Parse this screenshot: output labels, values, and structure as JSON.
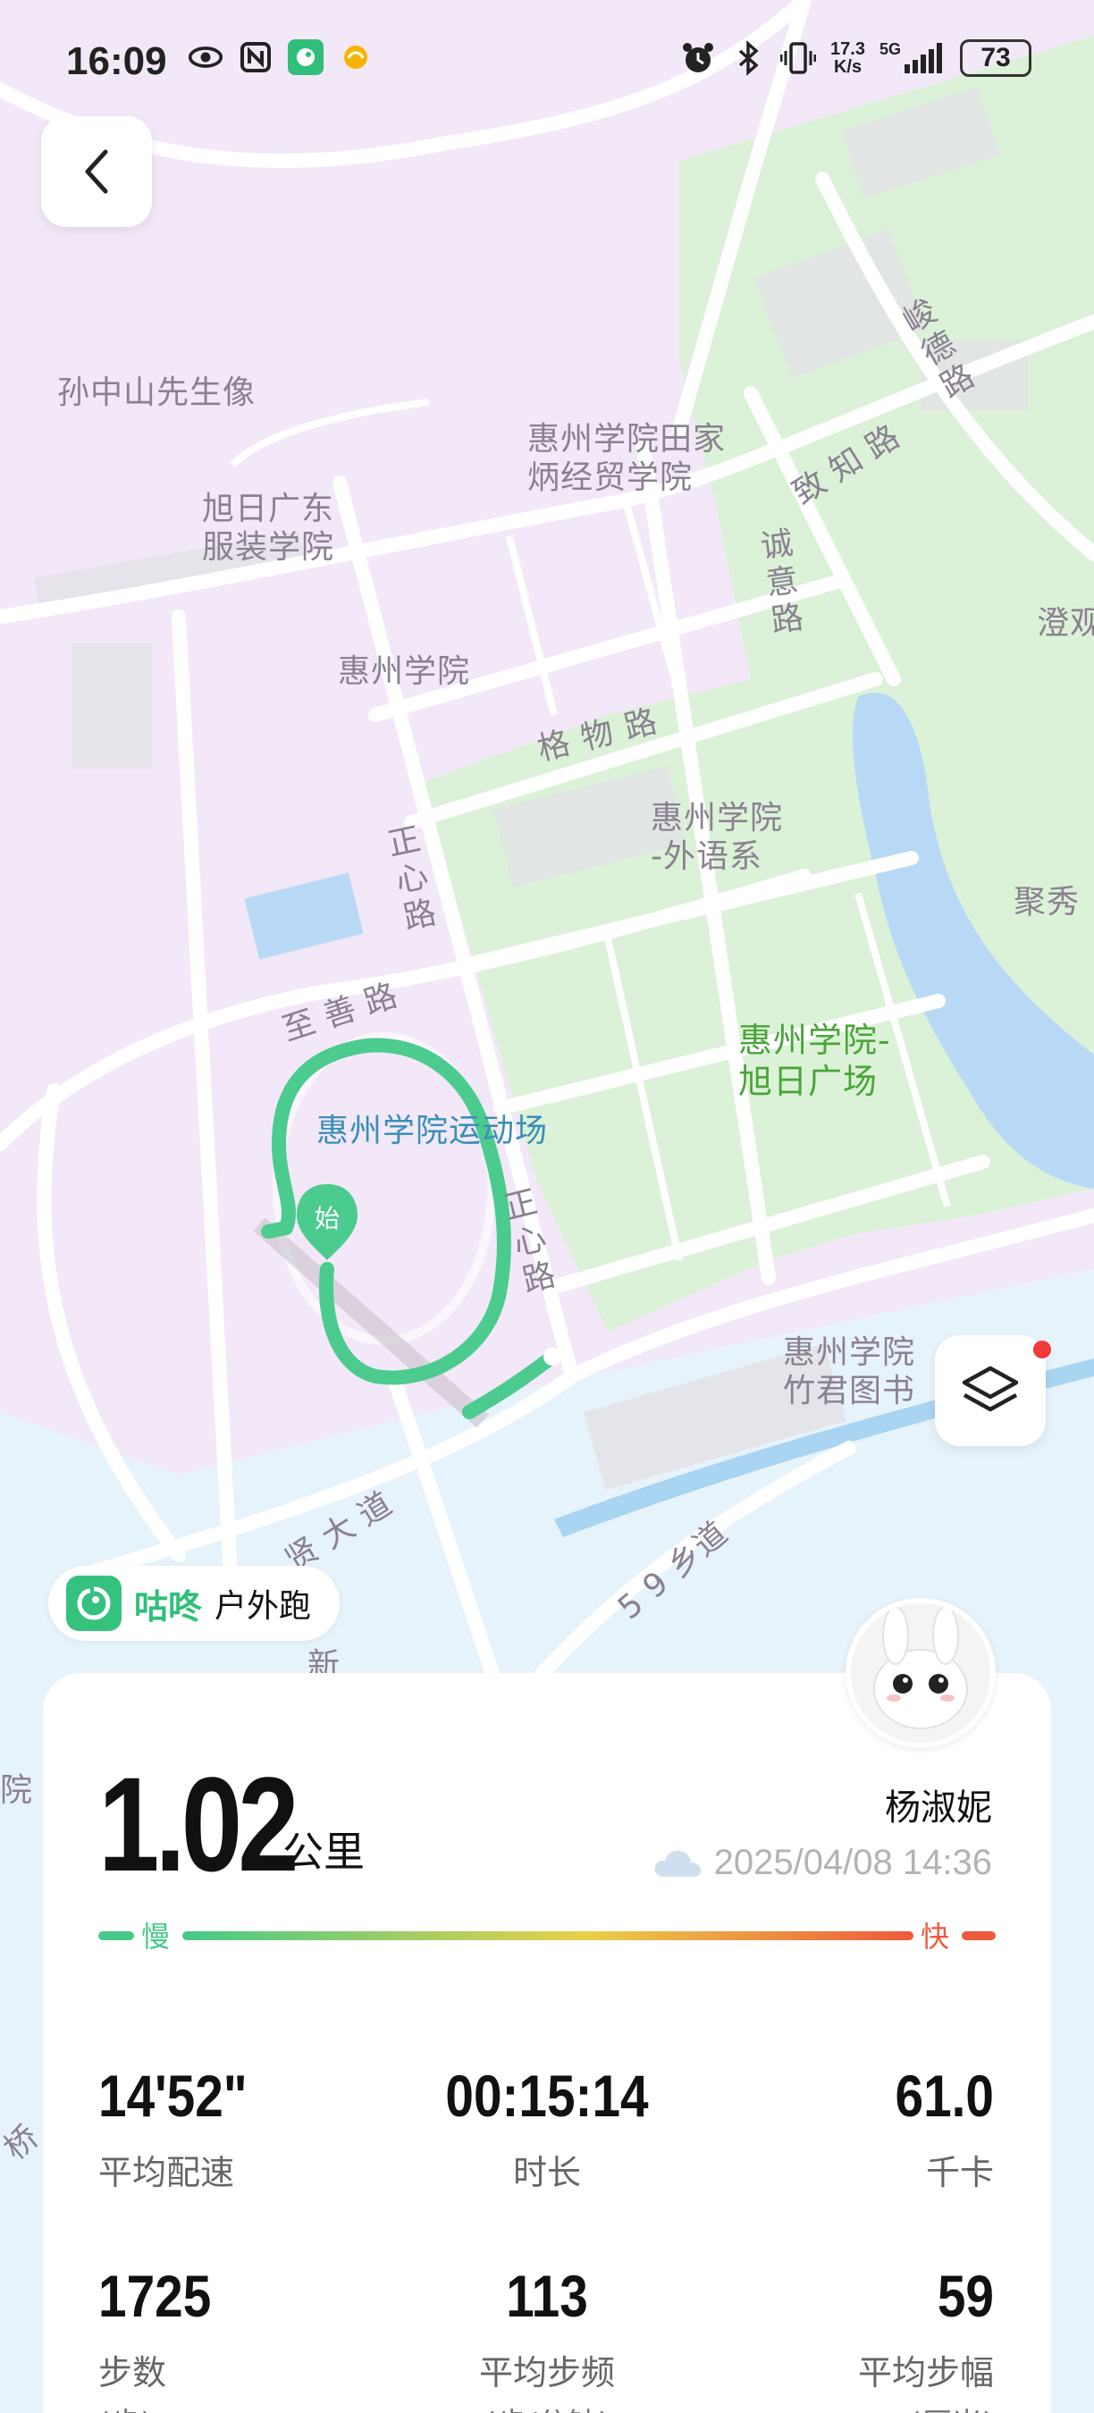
{
  "status_bar": {
    "time": "16:09",
    "net_speed_value": "17.3",
    "net_speed_unit": "K/s",
    "network": "5G",
    "battery": "73",
    "icons_left": [
      "eye-icon",
      "nfc-icon",
      "gudong-app-icon",
      "notification-app-icon"
    ],
    "icons_right": [
      "alarm-icon",
      "bluetooth-icon",
      "vibrate-icon",
      "signal-icon",
      "battery-icon"
    ]
  },
  "map": {
    "labels": {
      "sun_yatsen": "孙中山先生像",
      "tianjiabing": "惠州学院田家\n炳经贸学院",
      "xuri_fashion": "旭日广东\n服装学院",
      "huizhou_univ": "惠州学院",
      "gewu_road": "格物路",
      "foreign_lang": "惠州学院\n-外语系",
      "zhengxin_road_1": "正心路",
      "zhishan_road": "至善路",
      "xuri_square": "惠州学院-\n旭日广场",
      "stadium": "惠州学院运动场",
      "zhengxin_road_2": "正心路",
      "zhuojun_library": "惠州学院\n竹君图书",
      "xian_avenue": "贤大道",
      "township_59": "5 9 乡道",
      "xin": "新",
      "zhizhi_road": "致知路",
      "chengyi_road": "诚意路",
      "junde_road": "峻德路",
      "chengguan": "澄观",
      "juxiu": "聚秀",
      "yuan": "院",
      "qiao": "桥",
      "start_marker": "始"
    },
    "route_color": "#4ccb8e"
  },
  "activity": {
    "app_name": "咕咚",
    "type": "户外跑",
    "distance": "1.02",
    "distance_unit": "公里",
    "user_name": "杨淑妮",
    "datetime": "2025/04/08 14:36",
    "pace_slow_label": "慢",
    "pace_fast_label": "快"
  },
  "stats": [
    {
      "value": "14'52\"",
      "label": "平均配速",
      "sub": ""
    },
    {
      "value": "00:15:14",
      "label": "时长",
      "sub": ""
    },
    {
      "value": "61.0",
      "label": "千卡",
      "sub": ""
    },
    {
      "value": "1725",
      "label": "步数",
      "sub": "(步)"
    },
    {
      "value": "113",
      "label": "平均步频",
      "sub": "(步/分钟)"
    },
    {
      "value": "59",
      "label": "平均步幅",
      "sub": "(厘米)"
    }
  ],
  "colors": {
    "accent_green": "#2fbf7a",
    "pace_slow": "#46c988",
    "pace_mid": "#e8d04a",
    "pace_fast": "#ee5a3c",
    "map_residential": "#f3e8f8",
    "map_park": "#dcf2d8",
    "map_water": "#b8d9f5"
  }
}
